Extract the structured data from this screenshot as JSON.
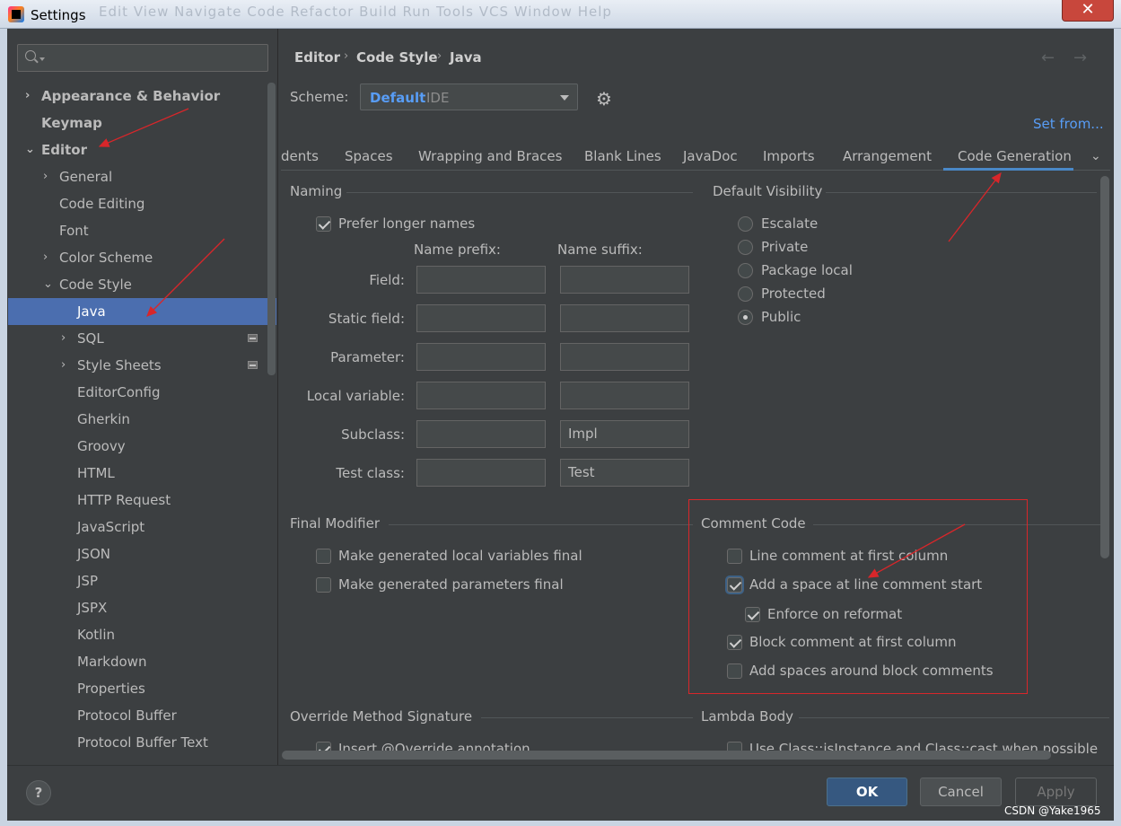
{
  "window": {
    "title": "Settings",
    "close_glyph": "✕",
    "menu_ghost": "Edit  View  Navigate  Code  Refactor  Build  Run  Tools  VCS  Window  Help"
  },
  "sidebar": {
    "items": [
      {
        "label": "Appearance & Behavior",
        "arrow": "›",
        "bold": true
      },
      {
        "label": "Keymap",
        "bold": true
      },
      {
        "label": "Editor",
        "arrow": "⌄",
        "bold": true
      },
      {
        "label": "General",
        "arrow": "›"
      },
      {
        "label": "Code Editing"
      },
      {
        "label": "Font"
      },
      {
        "label": "Color Scheme",
        "arrow": "›"
      },
      {
        "label": "Code Style",
        "arrow": "⌄"
      },
      {
        "label": "Java",
        "selected": true
      },
      {
        "label": "SQL",
        "arrow": "›",
        "project_icon": true
      },
      {
        "label": "Style Sheets",
        "arrow": "›",
        "project_icon": true
      },
      {
        "label": "EditorConfig"
      },
      {
        "label": "Gherkin"
      },
      {
        "label": "Groovy"
      },
      {
        "label": "HTML"
      },
      {
        "label": "HTTP Request"
      },
      {
        "label": "JavaScript"
      },
      {
        "label": "JSON"
      },
      {
        "label": "JSP"
      },
      {
        "label": "JSPX"
      },
      {
        "label": "Kotlin"
      },
      {
        "label": "Markdown"
      },
      {
        "label": "Properties"
      },
      {
        "label": "Protocol Buffer"
      },
      {
        "label": "Protocol Buffer Text"
      }
    ]
  },
  "breadcrumb": {
    "items": [
      "Editor",
      "Code Style",
      "Java"
    ],
    "separator": "›",
    "back": "←",
    "forward": "→"
  },
  "scheme": {
    "label": "Scheme:",
    "name": "Default",
    "kind": "IDE",
    "set_from": "Set from..."
  },
  "tabs": [
    "dents",
    "Spaces",
    "Wrapping and Braces",
    "Blank Lines",
    "JavaDoc",
    "Imports",
    "Arrangement",
    "Code Generation"
  ],
  "active_tab": "Code Generation",
  "tab_more": "⌄",
  "naming": {
    "title": "Naming",
    "prefer_longer": {
      "label": "Prefer longer names",
      "checked": true
    },
    "prefix_header": "Name prefix:",
    "suffix_header": "Name suffix:",
    "rows": [
      {
        "label": "Field:",
        "prefix": "",
        "suffix": ""
      },
      {
        "label": "Static field:",
        "prefix": "",
        "suffix": ""
      },
      {
        "label": "Parameter:",
        "prefix": "",
        "suffix": ""
      },
      {
        "label": "Local variable:",
        "prefix": "",
        "suffix": ""
      },
      {
        "label": "Subclass:",
        "prefix": "",
        "suffix": "Impl"
      },
      {
        "label": "Test class:",
        "prefix": "",
        "suffix": "Test"
      }
    ]
  },
  "default_visibility": {
    "title": "Default Visibility",
    "options": [
      "Escalate",
      "Private",
      "Package local",
      "Protected",
      "Public"
    ],
    "selected": "Public"
  },
  "final_modifier": {
    "title": "Final Modifier",
    "options": [
      {
        "label": "Make generated local variables final",
        "checked": false
      },
      {
        "label": "Make generated parameters final",
        "checked": false
      }
    ]
  },
  "comment_code": {
    "title": "Comment Code",
    "options": [
      {
        "label": "Line comment at first column",
        "checked": false
      },
      {
        "label": "Add a space at line comment start",
        "checked": true
      },
      {
        "label": "Enforce on reformat",
        "checked": true
      },
      {
        "label": "Block comment at first column",
        "checked": true
      },
      {
        "label": "Add spaces around block comments",
        "checked": false
      }
    ]
  },
  "override_method": {
    "title": "Override Method Signature",
    "insert_override": {
      "label": "Insert @Override annotation",
      "checked": true
    }
  },
  "lambda_body": {
    "title": "Lambda Body",
    "use_class": {
      "label": "Use Class::isInstance and Class::cast when possible",
      "checked": false
    }
  },
  "buttons": {
    "help": "?",
    "ok": "OK",
    "cancel": "Cancel",
    "apply": "Apply"
  },
  "watermark": "CSDN @Yake1965",
  "colors": {
    "accent": "#589df6",
    "selection": "#4b6eaf",
    "annotation": "#d8262a"
  }
}
